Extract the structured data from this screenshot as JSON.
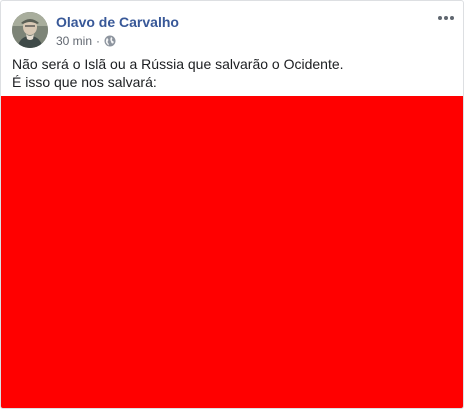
{
  "post": {
    "author": "Olavo de Carvalho",
    "timestamp": "30 min",
    "separator": "·",
    "privacy_icon": "globe-icon",
    "more_icon": "more-options-icon",
    "text_lines": [
      "Não será o Islã ou a Rússia que salvarão o Ocidente.",
      "É isso que nos salvará:"
    ],
    "media_color": "#ff0000"
  },
  "colors": {
    "author": "#385898",
    "meta": "#616770",
    "text": "#1c1e21",
    "border": "#dddfe2"
  }
}
